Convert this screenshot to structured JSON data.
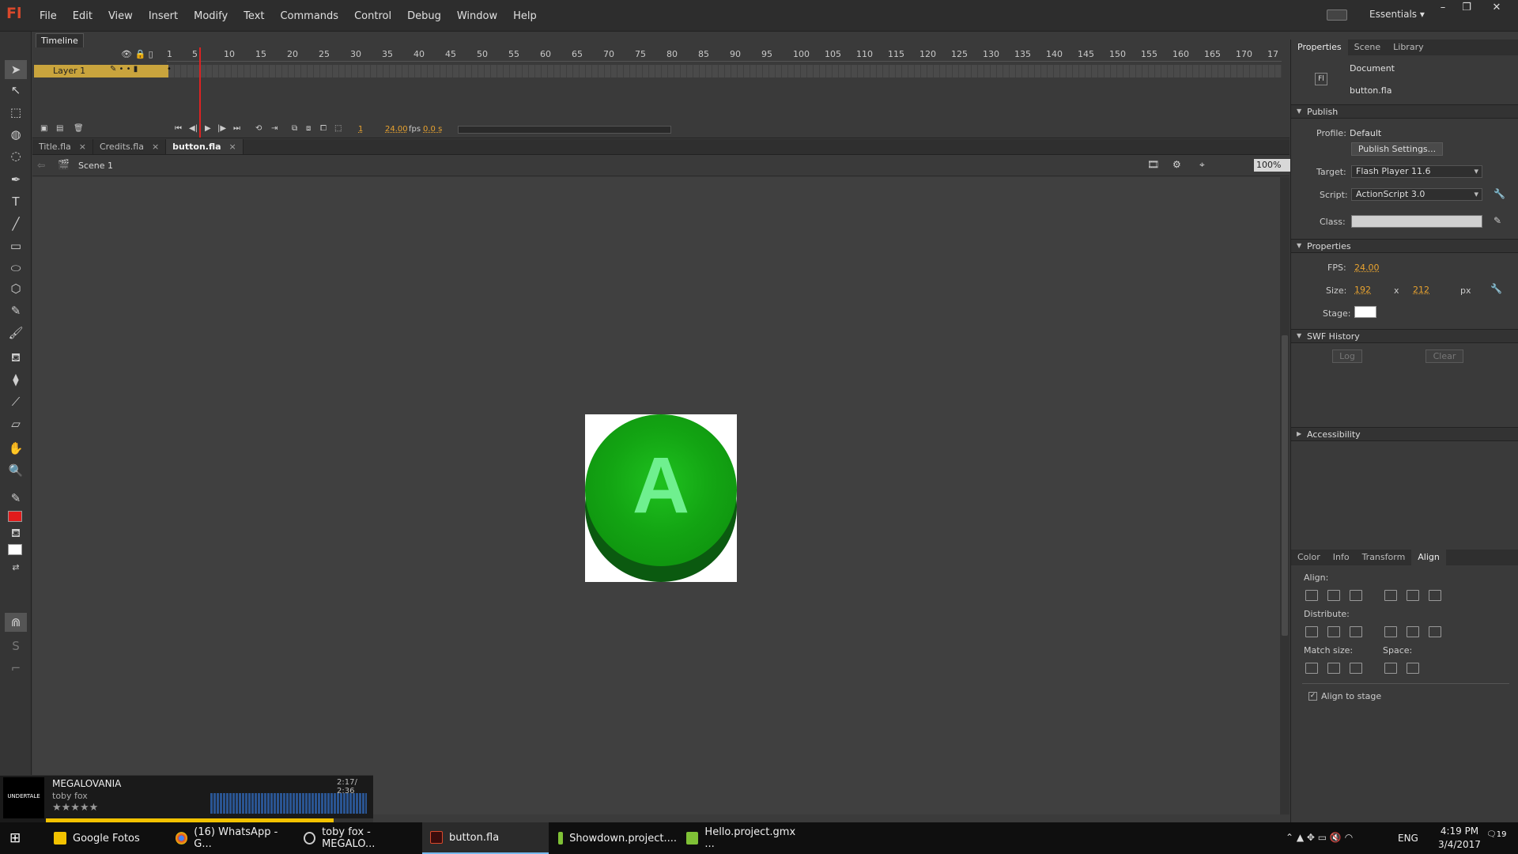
{
  "app": {
    "logo": "Fl"
  },
  "menu": [
    "File",
    "Edit",
    "View",
    "Insert",
    "Modify",
    "Text",
    "Commands",
    "Control",
    "Debug",
    "Window",
    "Help"
  ],
  "workspace": {
    "label": "Essentials"
  },
  "window_controls": {
    "minimize": "–",
    "restore": "❐",
    "close": "✕"
  },
  "timeline": {
    "tab_label": "Timeline",
    "frame_numbers": [
      "1",
      "5",
      "10",
      "15",
      "20",
      "25",
      "30",
      "35",
      "40",
      "45",
      "50",
      "55",
      "60",
      "65",
      "70",
      "75",
      "80",
      "85",
      "90",
      "95",
      "100",
      "105",
      "110",
      "115",
      "120",
      "125",
      "130",
      "135",
      "140",
      "145",
      "150",
      "155",
      "160",
      "165",
      "170",
      "17"
    ],
    "layer_name": "Layer 1",
    "current_frame": "1",
    "fps": "24.00",
    "fps_unit": "fps",
    "time": "0.0 s"
  },
  "doc_tabs": [
    {
      "label": "Title.fla",
      "active": false
    },
    {
      "label": "Credits.fla",
      "active": false
    },
    {
      "label": "button.fla",
      "active": true
    }
  ],
  "edit_bar": {
    "scene": "Scene 1",
    "zoom": "100%"
  },
  "stage": {
    "button_letter": "A",
    "bg_color": "#ffffff",
    "circle_color": "#109910",
    "letter_color": "#6ff08f"
  },
  "properties_panel": {
    "tabs": [
      "Properties",
      "Scene",
      "Library"
    ],
    "doc_type": "Document",
    "doc_name": "button.fla",
    "publish": {
      "header": "Publish",
      "profile_label": "Profile:",
      "profile_value": "Default",
      "settings_button": "Publish Settings...",
      "target_label": "Target:",
      "target_value": "Flash Player 11.6",
      "script_label": "Script:",
      "script_value": "ActionScript 3.0",
      "class_label": "Class:"
    },
    "properties": {
      "header": "Properties",
      "fps_label": "FPS:",
      "fps_value": "24.00",
      "size_label": "Size:",
      "width": "192",
      "x": "x",
      "height": "212",
      "unit": "px",
      "stage_label": "Stage:"
    },
    "swf_history": {
      "header": "SWF History",
      "log": "Log",
      "clear": "Clear"
    },
    "accessibility": {
      "header": "Accessibility"
    }
  },
  "align_panel": {
    "tabs": [
      "Color",
      "Info",
      "Transform",
      "Align"
    ],
    "align_label": "Align:",
    "distribute_label": "Distribute:",
    "match_size_label": "Match size:",
    "space_label": "Space:",
    "align_to_stage": "Align to stage"
  },
  "music_widget": {
    "title": "MEGALOVANIA",
    "artist": "toby fox",
    "time": "2:17/ 2:36",
    "rating": "★★★★★",
    "logo_text": "UNDERTALE",
    "progress": 0.88
  },
  "taskbar": {
    "items": [
      {
        "label": "Google Fotos"
      },
      {
        "label": "(16) WhatsApp - G..."
      },
      {
        "label": "toby fox - MEGALO..."
      },
      {
        "label": "button.fla"
      },
      {
        "label": "Showdown.project...."
      },
      {
        "label": "Hello.project.gmx ..."
      }
    ],
    "language": "ENG",
    "clock_time": "4:19 PM",
    "clock_date": "3/4/2017",
    "notifications": "19"
  }
}
